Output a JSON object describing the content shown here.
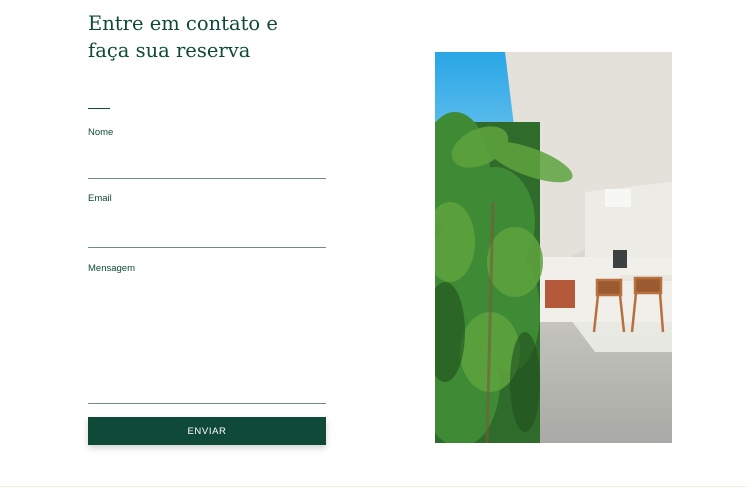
{
  "contact": {
    "title_line1": "Entre em contato e",
    "title_line2": "faça sua reserva"
  },
  "form": {
    "name_label": "Nome",
    "name_value": "",
    "email_label": "Email",
    "email_value": "",
    "message_label": "Mensagem",
    "message_value": "",
    "submit_label": "ENVIAR"
  },
  "colors": {
    "primary": "#0f4a38",
    "field_line": "#6f8c83",
    "background": "#ffffff"
  }
}
